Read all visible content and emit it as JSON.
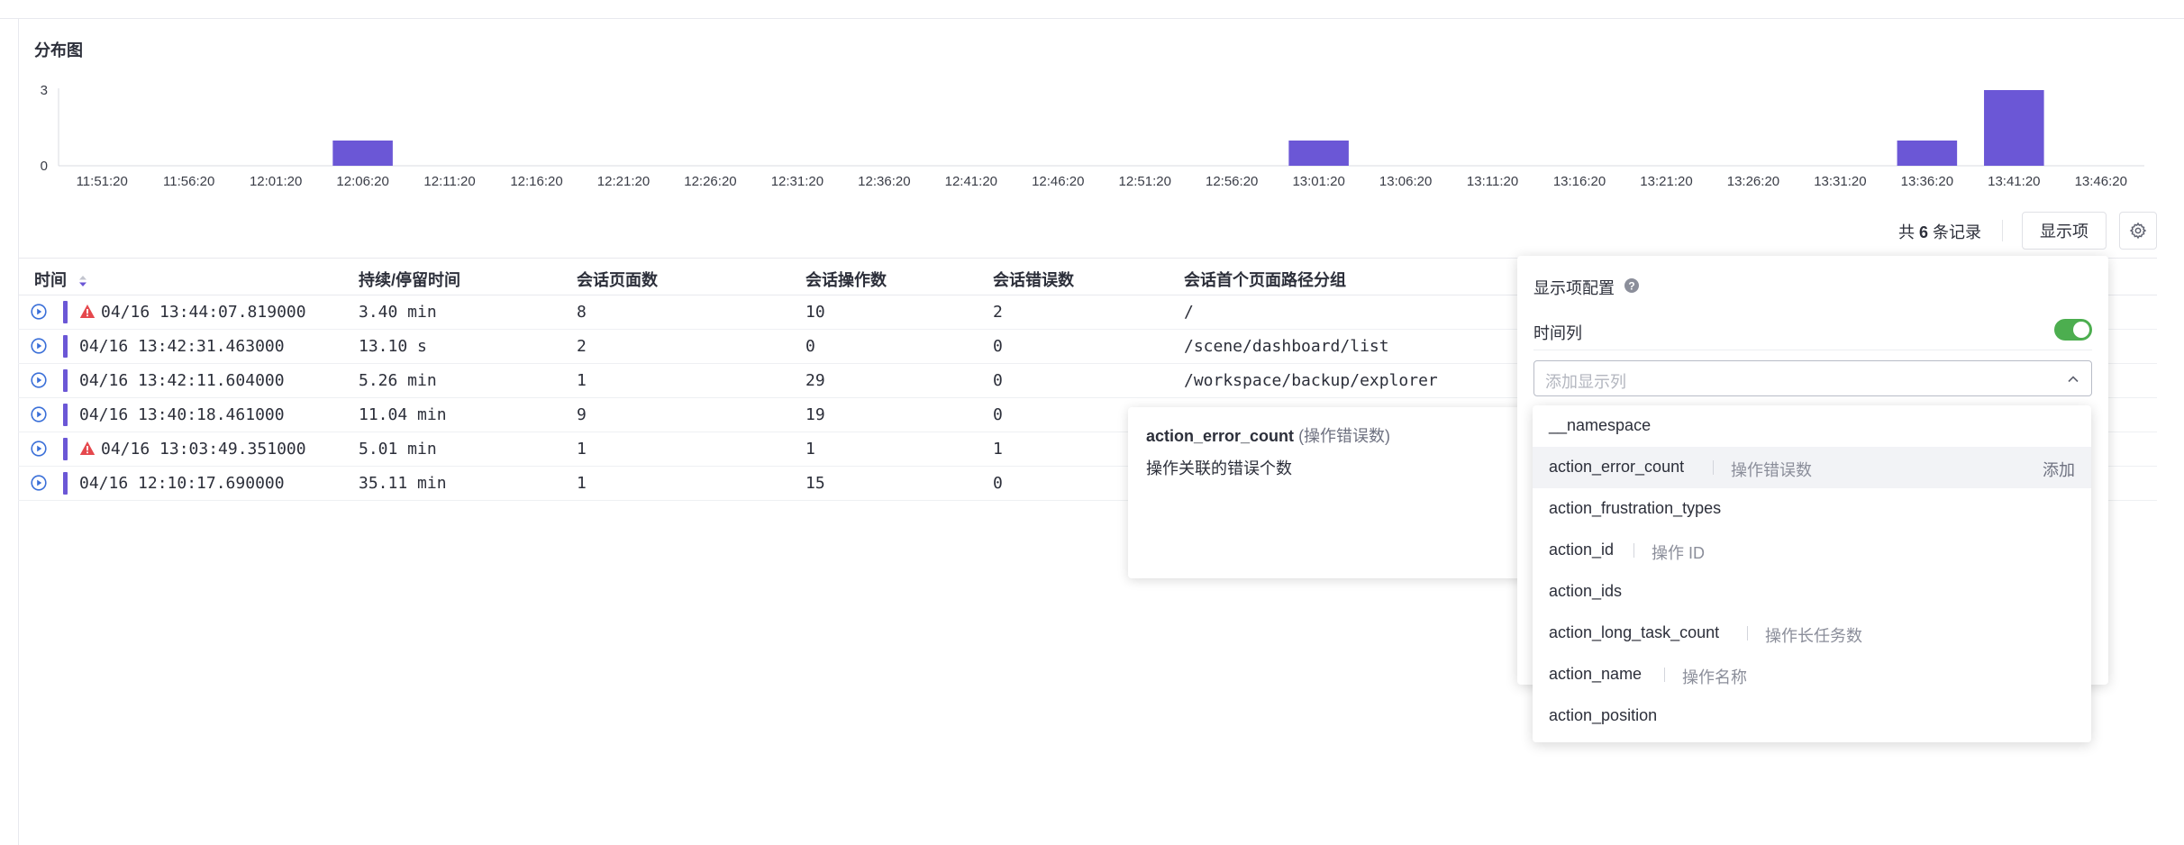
{
  "chart": {
    "title": "分布图"
  },
  "chart_data": {
    "type": "bar",
    "ylim": [
      0,
      3
    ],
    "y_ticks": [
      "0",
      "3"
    ],
    "x_tick_labels": [
      "11:51:20",
      "11:56:20",
      "12:01:20",
      "12:06:20",
      "12:11:20",
      "12:16:20",
      "12:21:20",
      "12:26:20",
      "12:31:20",
      "12:36:20",
      "12:41:20",
      "12:46:20",
      "12:51:20",
      "12:56:20",
      "13:01:20",
      "13:06:20",
      "13:11:20",
      "13:16:20",
      "13:21:20",
      "13:26:20",
      "13:31:20",
      "13:36:20",
      "13:41:20",
      "13:46:20"
    ],
    "values": [
      0,
      0,
      0,
      1,
      0,
      0,
      0,
      0,
      0,
      0,
      0,
      0,
      0,
      0,
      1,
      0,
      0,
      0,
      0,
      0,
      0,
      1,
      3,
      0
    ],
    "bar_color": "#6b57d6",
    "grid": false
  },
  "toolbar": {
    "count_prefix": "共",
    "count_value": "6",
    "count_suffix": "条记录",
    "display_button": "显示项"
  },
  "table": {
    "columns": [
      "时间",
      "持续/停留时间",
      "会话页面数",
      "会话操作数",
      "会话错误数",
      "会话首个页面路径分组"
    ],
    "rows": [
      {
        "time": "04/16 13:44:07.819000",
        "warn": true,
        "duration": "3.40 min",
        "pages": "8",
        "actions": "10",
        "errors": "2",
        "path": "/"
      },
      {
        "time": "04/16 13:42:31.463000",
        "warn": false,
        "duration": "13.10 s",
        "pages": "2",
        "actions": "0",
        "errors": "0",
        "path": "/scene/dashboard/list"
      },
      {
        "time": "04/16 13:42:11.604000",
        "warn": false,
        "duration": "5.26 min",
        "pages": "1",
        "actions": "29",
        "errors": "0",
        "path": "/workspace/backup/explorer"
      },
      {
        "time": "04/16 13:40:18.461000",
        "warn": false,
        "duration": "11.04 min",
        "pages": "9",
        "actions": "19",
        "errors": "0",
        "path": ""
      },
      {
        "time": "04/16 13:03:49.351000",
        "warn": true,
        "duration": "5.01 min",
        "pages": "1",
        "actions": "1",
        "errors": "1",
        "path": ""
      },
      {
        "time": "04/16 12:10:17.690000",
        "warn": false,
        "duration": "35.11 min",
        "pages": "1",
        "actions": "15",
        "errors": "0",
        "path": ""
      }
    ]
  },
  "tooltip": {
    "field": "action_error_count",
    "label": "(操作错误数)",
    "description": "操作关联的错误个数"
  },
  "config": {
    "title": "显示项配置",
    "time_column_label": "时间列",
    "time_column_enabled": true,
    "select_placeholder": "添加显示列",
    "options": [
      {
        "name": "__namespace",
        "desc": ""
      },
      {
        "name": "action_error_count",
        "desc": "操作错误数",
        "add": "添加",
        "hover": true
      },
      {
        "name": "action_frustration_types",
        "desc": ""
      },
      {
        "name": "action_id",
        "desc": "操作 ID"
      },
      {
        "name": "action_ids",
        "desc": ""
      },
      {
        "name": "action_long_task_count",
        "desc": "操作长任务数"
      },
      {
        "name": "action_name",
        "desc": "操作名称"
      },
      {
        "name": "action_position",
        "desc": ""
      }
    ]
  },
  "colors": {
    "accent": "#6b57d6",
    "toggle_on": "#4cae4f",
    "warning": "#e5484d"
  }
}
